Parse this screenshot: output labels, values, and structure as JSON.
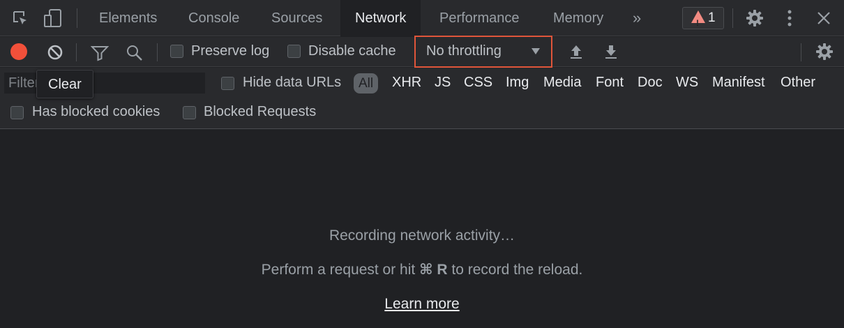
{
  "tabs": [
    {
      "label": "Elements",
      "active": false
    },
    {
      "label": "Console",
      "active": false
    },
    {
      "label": "Sources",
      "active": false
    },
    {
      "label": "Network",
      "active": true
    },
    {
      "label": "Performance",
      "active": false
    },
    {
      "label": "Memory",
      "active": false
    }
  ],
  "tabbar": {
    "more_tabs_glyph": "»",
    "issues_count": "1"
  },
  "toolbar": {
    "preserve_log_label": "Preserve log",
    "disable_cache_label": "Disable cache",
    "throttling_value": "No throttling"
  },
  "filter": {
    "placeholder": "Filter",
    "clear_tooltip": "Clear",
    "hide_data_urls_label": "Hide data URLs",
    "types": [
      "All",
      "XHR",
      "JS",
      "CSS",
      "Img",
      "Media",
      "Font",
      "Doc",
      "WS",
      "Manifest",
      "Other"
    ],
    "has_blocked_cookies_label": "Has blocked cookies",
    "blocked_requests_label": "Blocked Requests"
  },
  "empty_state": {
    "recording": "Recording network activity…",
    "hint_before": "Perform a request or hit ",
    "hint_keys": "⌘ R",
    "hint_after": " to record the reload.",
    "learn_more": "Learn more"
  },
  "colors": {
    "record": "#f2503a",
    "highlight_border": "#e0553a",
    "warning": "#f28b82"
  }
}
